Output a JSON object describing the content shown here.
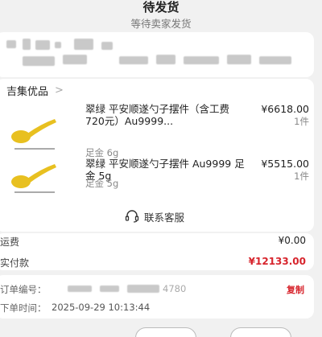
{
  "status": {
    "title": "待发货",
    "subtitle": "等待卖家发货"
  },
  "shop": {
    "name": "吉集优品",
    "chevron": ">"
  },
  "items": [
    {
      "title": "翠绿  平安顺遂勺子摆件（含工费720元）Au9999...",
      "spec": "足金 6g",
      "price": "¥6618.00",
      "qty": "1件"
    },
    {
      "title": "翠绿  平安顺遂勺子摆件 Au9999 足金 5g",
      "spec": "足金 5g",
      "price": "¥5515.00",
      "qty": "1件"
    }
  ],
  "service": {
    "label": "联系客服",
    "icon": "headset-icon"
  },
  "summary": {
    "shipping_label": "运费",
    "shipping_value": "¥0.00",
    "paid_label": "实付款",
    "paid_value": "¥12133.00"
  },
  "order_info": {
    "number_label": "订单编号：",
    "number_tail": "4780",
    "copy_label": "复制",
    "time_label": "下单时间：",
    "time_value": "2025-09-29 10:13:44"
  },
  "colors": {
    "accent": "#d7242c",
    "background": "#f1f1f1",
    "gold": "#e8c020"
  }
}
